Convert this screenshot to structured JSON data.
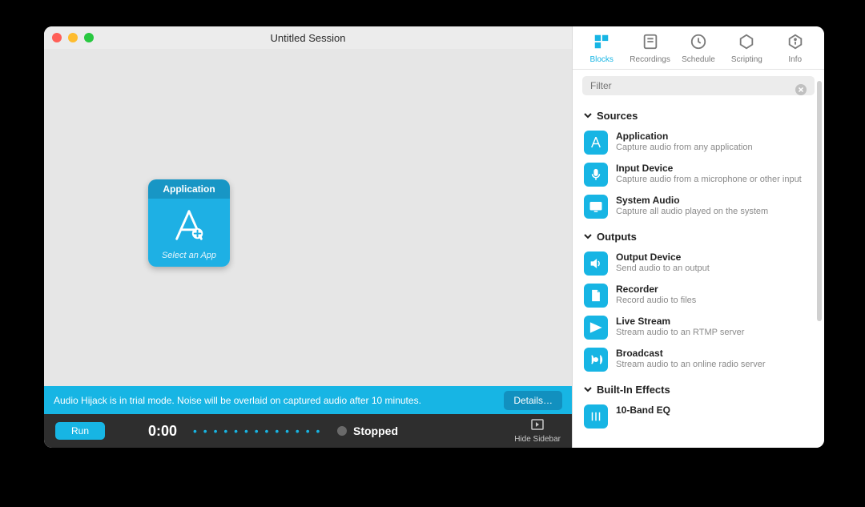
{
  "window": {
    "title": "Untitled Session"
  },
  "block": {
    "header": "Application",
    "sub": "Select an App"
  },
  "trial": {
    "message": "Audio Hijack is in trial mode. Noise will be overlaid on captured audio after 10 minutes.",
    "details": "Details…"
  },
  "status": {
    "run": "Run",
    "timer": "0:00",
    "state": "Stopped",
    "hide_sidebar": "Hide Sidebar"
  },
  "tabs": {
    "blocks": "Blocks",
    "recordings": "Recordings",
    "schedule": "Schedule",
    "scripting": "Scripting",
    "info": "Info"
  },
  "filter": {
    "placeholder": "Filter"
  },
  "sections": {
    "sources": "Sources",
    "outputs": "Outputs",
    "effects": "Built-In Effects"
  },
  "items": {
    "app": {
      "title": "Application",
      "desc": "Capture audio from any application"
    },
    "input": {
      "title": "Input Device",
      "desc": "Capture audio from a microphone or other input"
    },
    "system": {
      "title": "System Audio",
      "desc": "Capture all audio played on the system"
    },
    "output": {
      "title": "Output Device",
      "desc": "Send audio to an output"
    },
    "recorder": {
      "title": "Recorder",
      "desc": "Record audio to files"
    },
    "stream": {
      "title": "Live Stream",
      "desc": "Stream audio to an RTMP server"
    },
    "broadcast": {
      "title": "Broadcast",
      "desc": "Stream audio to an online radio server"
    },
    "eq": {
      "title": "10-Band EQ",
      "desc": ""
    }
  },
  "colors": {
    "accent": "#17b5e4"
  }
}
